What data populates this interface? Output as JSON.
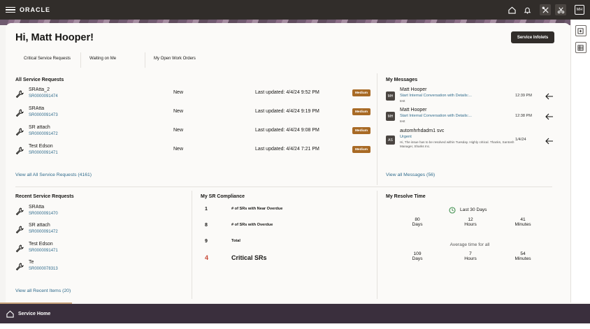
{
  "header": {
    "logo": "ORACLE",
    "avatar_initials": "MH"
  },
  "greeting": "Hi, Matt Hooper!",
  "service_infolets_label": "Service Infolets",
  "tabs": [
    {
      "label": "Critical Service Requests"
    },
    {
      "label": "Waiting on Me"
    },
    {
      "label": "My Open Work Orders"
    }
  ],
  "all_sr": {
    "title": "All Service Requests",
    "rows": [
      {
        "title": "SRAtta_2",
        "number": "SR0000091474",
        "status": "New",
        "updated": "Last updated: 4/4/24 9:52 PM",
        "priority": "Medium"
      },
      {
        "title": "SRAtta",
        "number": "SR0000091473",
        "status": "New",
        "updated": "Last updated: 4/4/24 9:19 PM",
        "priority": "Medium"
      },
      {
        "title": "SR attach",
        "number": "SR0000091472",
        "status": "New",
        "updated": "Last updated: 4/4/24 9:08 PM",
        "priority": "Medium"
      },
      {
        "title": "Test Edson",
        "number": "SR0000091471",
        "status": "New",
        "updated": "Last updated: 4/4/24 7:21 PM",
        "priority": "Medium"
      }
    ],
    "view_all": "View all All Service Requests (4161)"
  },
  "messages": {
    "title": "My Messages",
    "items": [
      {
        "initials": "MH",
        "name": "Matt Hooper",
        "subject": "Start Internal Conversation with Details:...",
        "body": "test",
        "time": "12:39 PM"
      },
      {
        "initials": "MH",
        "name": "Matt Hooper",
        "subject": "Start Internal Conversation with Details:...",
        "body": "test",
        "time": "12:38 PM"
      },
      {
        "initials": "AS",
        "name": "automhrhdadm1 svc",
        "subject": "Urgent",
        "body": "Hi, The issue has to be resolved within Tuesday. Highly critical. Thanks, Santosh Manager, Sharks Inc.",
        "time": "1/4/24"
      }
    ],
    "view_all": "View all Messages (56)"
  },
  "recent_sr": {
    "title": "Recent Service Requests",
    "rows": [
      {
        "title": "SRAtta",
        "number": "SR0000091470"
      },
      {
        "title": "SR attach",
        "number": "SR0000091472"
      },
      {
        "title": "Test Edson",
        "number": "SR0000091471"
      },
      {
        "title": "Te",
        "number": "SR0000078313"
      }
    ],
    "view_all": "View all Recent Items (20)"
  },
  "compliance": {
    "title": "My SR Compliance",
    "rows": [
      {
        "value": "1",
        "label": "# of SRs with Near Overdue"
      },
      {
        "value": "8",
        "label": "# of SRs with Overdue"
      },
      {
        "value": "9",
        "label": "Total"
      }
    ],
    "critical": {
      "value": "4",
      "label": "Critical SRs"
    },
    "critical_color": "#c74634"
  },
  "resolve": {
    "title": "My Resolve Time",
    "period": "Last 30 Days",
    "last30": [
      {
        "value": "80",
        "unit": "Days"
      },
      {
        "value": "12",
        "unit": "Hours"
      },
      {
        "value": "41",
        "unit": "Minutes"
      }
    ],
    "avg_label": "Average time for all",
    "avg": [
      {
        "value": "109",
        "unit": "Days"
      },
      {
        "value": "7",
        "unit": "Hours"
      },
      {
        "value": "54",
        "unit": "Minutes"
      }
    ]
  },
  "footer": {
    "home_label": "Service Home"
  },
  "colors": {
    "topbar": "#312d2a",
    "badge": "#a86a25",
    "link": "#2f6b8c",
    "footer": "#3a2f3d",
    "accent": "#c9a47c"
  }
}
